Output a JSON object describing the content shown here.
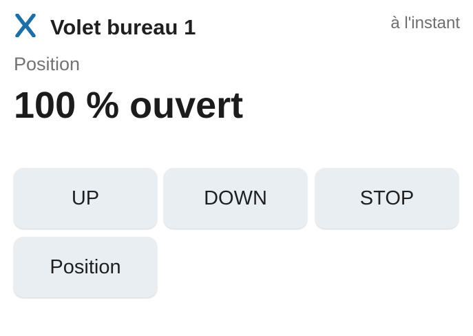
{
  "header": {
    "icon": "x-brand-icon",
    "title": "Volet bureau 1",
    "timestamp": "à l'instant"
  },
  "state": {
    "label": "Position",
    "value": "100 % ouvert"
  },
  "actions": {
    "up_label": "UP",
    "down_label": "DOWN",
    "stop_label": "STOP",
    "position_label": "Position"
  },
  "colors": {
    "icon_blue": "#1e6fa8",
    "button_bg": "#e9eef3"
  }
}
